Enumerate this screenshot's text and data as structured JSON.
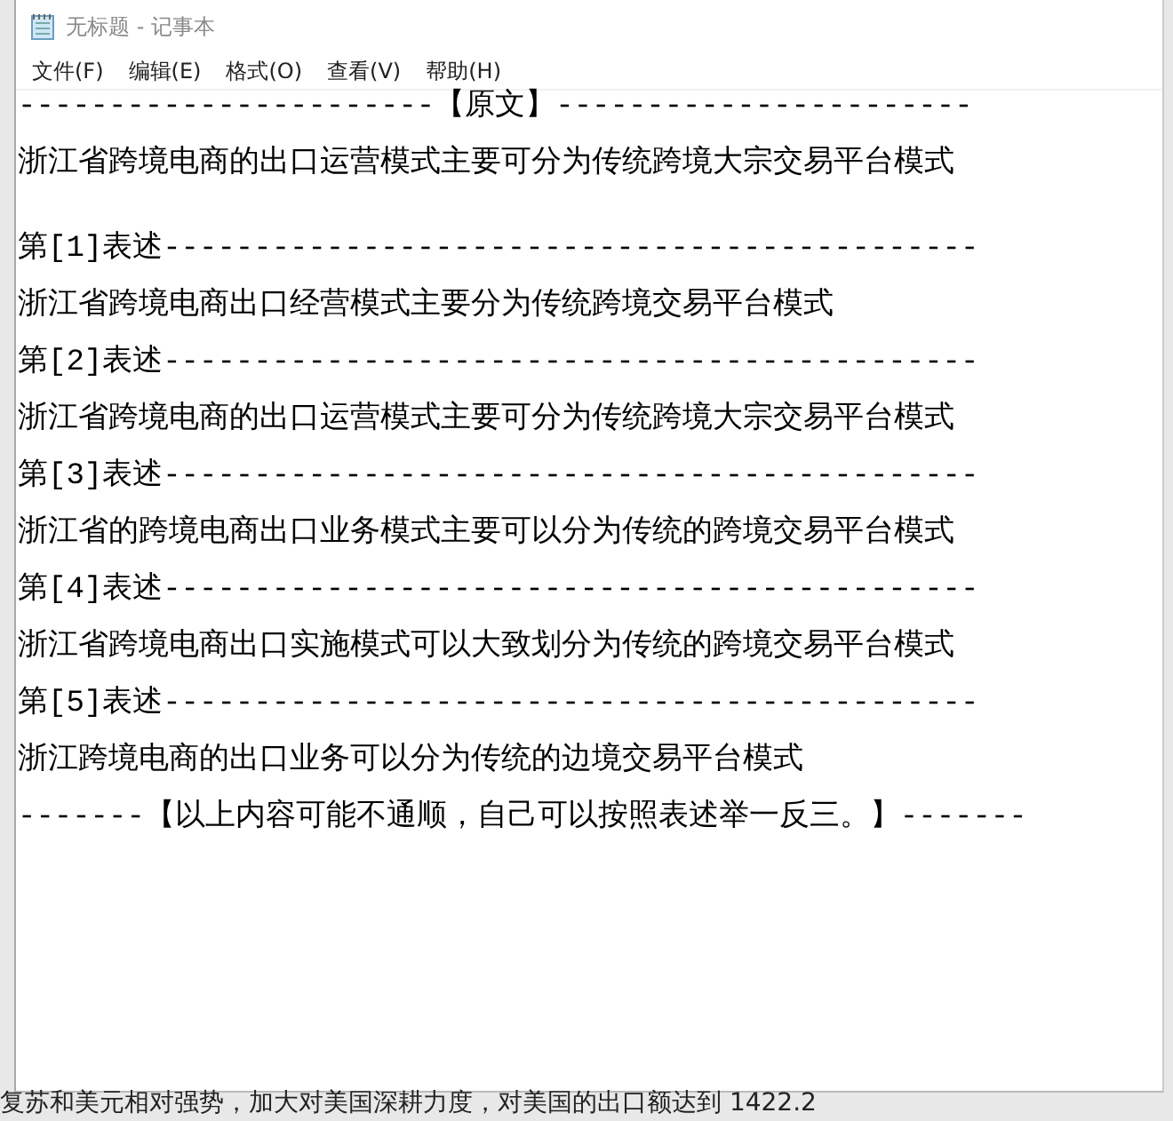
{
  "window": {
    "title": "无标题 - 记事本"
  },
  "menu": [
    "文件(F)",
    "编辑(E)",
    "格式(O)",
    "查看(V)",
    "帮助(H)"
  ],
  "lines": [
    {
      "kind": "rule",
      "text": "-----------------------【原文】-----------------------"
    },
    {
      "kind": "original",
      "text": "浙江省跨境电商的出口运营模式主要可分为传统跨境大宗交易平台模式"
    },
    {
      "kind": "rule",
      "text": "第[1]表述---------------------------------------------"
    },
    {
      "kind": "text",
      "text": "浙江省跨境电商出口经营模式主要分为传统跨境交易平台模式"
    },
    {
      "kind": "rule",
      "text": "第[2]表述---------------------------------------------"
    },
    {
      "kind": "text",
      "text": "浙江省跨境电商的出口运营模式主要可分为传统跨境大宗交易平台模式"
    },
    {
      "kind": "rule",
      "text": "第[3]表述---------------------------------------------"
    },
    {
      "kind": "text",
      "text": "浙江省的跨境电商出口业务模式主要可以分为传统的跨境交易平台模式"
    },
    {
      "kind": "rule",
      "text": "第[4]表述---------------------------------------------"
    },
    {
      "kind": "text",
      "text": "浙江省跨境电商出口实施模式可以大致划分为传统的跨境交易平台模式"
    },
    {
      "kind": "rule",
      "text": "第[5]表述---------------------------------------------"
    },
    {
      "kind": "text",
      "text": "浙江跨境电商的出口业务可以分为传统的边境交易平台模式"
    },
    {
      "kind": "rule",
      "text": "-------【以上内容可能不通顺，自己可以按照表述举一反三。】-------"
    }
  ],
  "background_text": "复苏和美元相对强势，加大对美国深耕力度，对美国的出口额达到 1422.2"
}
